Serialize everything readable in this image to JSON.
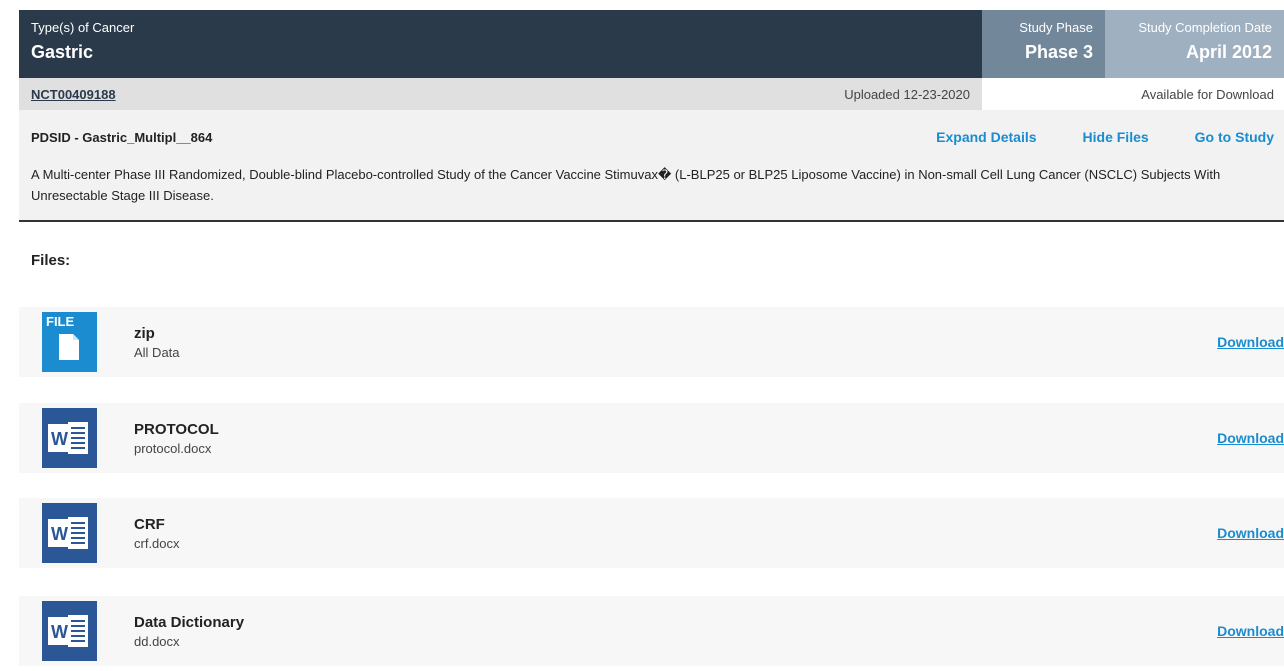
{
  "header": {
    "cancer_label": "Type(s) of Cancer",
    "cancer_value": "Gastric",
    "phase_label": "Study Phase",
    "phase_value": "Phase 3",
    "completion_label": "Study Completion Date",
    "completion_value": "April 2012"
  },
  "nct": {
    "id": "NCT00409188",
    "uploaded": "Uploaded 12-23-2020",
    "availability": "Available for Download"
  },
  "details": {
    "pdsid": "PDSID - Gastric_Multipl__864",
    "actions": [
      "Expand Details",
      "Hide Files",
      "Go to Study"
    ],
    "description": "A Multi-center Phase III Randomized, Double-blind Placebo-controlled Study of the Cancer Vaccine Stimuvax� (L-BLP25 or BLP25 Liposome Vaccine) in Non-small Cell Lung Cancer (NSCLC) Subjects With Unresectable Stage III Disease."
  },
  "files_title": "Files:",
  "files": [
    {
      "icon": "generic-file-icon",
      "icon_text": "FILE",
      "title": "zip",
      "subtitle": "All Data",
      "action": "Download"
    },
    {
      "icon": "word-doc-icon",
      "icon_text": "W",
      "title": "PROTOCOL",
      "subtitle": "protocol.docx",
      "action": "Download"
    },
    {
      "icon": "word-doc-icon",
      "icon_text": "W",
      "title": "CRF",
      "subtitle": "crf.docx",
      "action": "Download"
    },
    {
      "icon": "word-doc-icon",
      "icon_text": "W",
      "title": "Data Dictionary",
      "subtitle": "dd.docx",
      "action": "Download"
    }
  ],
  "colors": {
    "header_dark": "#2b3a4a",
    "phase_bg": "#73879a",
    "date_bg": "#9fb0c0",
    "link": "#1a8ccf",
    "file_icon_blue": "#1a8ccf",
    "word_icon_blue": "#2b5797"
  }
}
